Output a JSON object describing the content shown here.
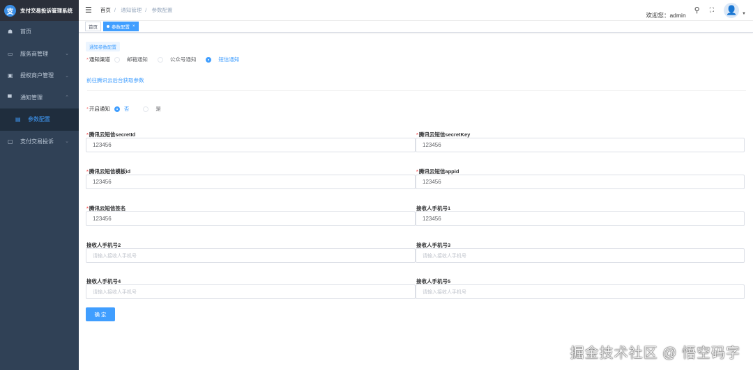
{
  "app": {
    "title": "支付交易投诉管理系统",
    "logo_char": "支"
  },
  "sidebar": {
    "items": [
      {
        "label": "首页",
        "icon": "dashboard-icon",
        "glyph": "☗"
      },
      {
        "label": "服务商管理",
        "icon": "server-icon",
        "glyph": "▭",
        "arrow": "⌄"
      },
      {
        "label": "授权商户管理",
        "icon": "merchant-icon",
        "glyph": "▣",
        "arrow": "⌄"
      },
      {
        "label": "通知管理",
        "icon": "message-icon",
        "glyph": "▀",
        "arrow": "⌃"
      },
      {
        "label": "参数配置",
        "icon": "document-icon",
        "glyph": "▤"
      },
      {
        "label": "支付交易投诉",
        "icon": "monitor-icon",
        "glyph": "▢",
        "arrow": "⌄"
      }
    ]
  },
  "header": {
    "breadcrumb": [
      "首页",
      "通知管理",
      "参数配置"
    ],
    "welcome": "欢迎您：admin"
  },
  "tags": [
    {
      "label": "首页"
    },
    {
      "label": "参数配置"
    }
  ],
  "form": {
    "section_tag": "通知参数配置",
    "channel": {
      "label": "通知渠道",
      "options": [
        "邮箱通知",
        "公众号通知",
        "短信通知"
      ],
      "selected": "短信通知"
    },
    "link": "前往腾讯云后台获取参数",
    "enable": {
      "label": "开启通知",
      "options": [
        "否",
        "是"
      ],
      "selected": "否"
    },
    "fields": [
      {
        "label": "腾讯云短信secretId",
        "required": "*",
        "value": "123456",
        "placeholder": ""
      },
      {
        "label": "腾讯云短信secretKey",
        "required": "*",
        "value": "123456",
        "placeholder": ""
      },
      {
        "label": "腾讯云短信模板id",
        "required": "*",
        "value": "123456",
        "placeholder": ""
      },
      {
        "label": "腾讯云短信appid",
        "required": "*",
        "value": "123456",
        "placeholder": ""
      },
      {
        "label": "腾讯云短信签名",
        "required": "*",
        "value": "123456",
        "placeholder": ""
      },
      {
        "label": "接收人手机号1",
        "required": "",
        "value": "123456",
        "placeholder": ""
      },
      {
        "label": "接收人手机号2",
        "required": "",
        "value": "",
        "placeholder": "请输入接收人手机号"
      },
      {
        "label": "接收人手机号3",
        "required": "",
        "value": "",
        "placeholder": "请输入接收人手机号"
      },
      {
        "label": "接收人手机号4",
        "required": "",
        "value": "",
        "placeholder": "请输入接收人手机号"
      },
      {
        "label": "接收人手机号5",
        "required": "",
        "value": "",
        "placeholder": "请输入接收人手机号"
      }
    ],
    "submit": "确 定"
  },
  "watermark": "掘金技术社区 @ 悟空码字",
  "colors": {
    "primary": "#409eff",
    "sidebar": "#304156",
    "danger": "#f56c6c"
  }
}
